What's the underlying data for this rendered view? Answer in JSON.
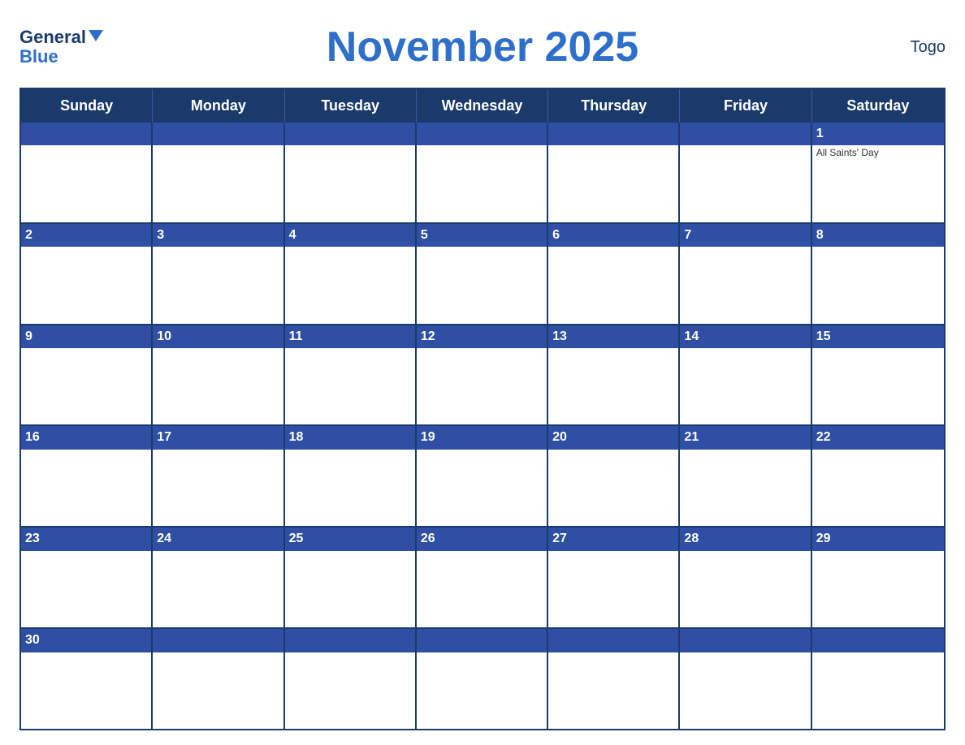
{
  "header": {
    "logo_general": "General",
    "logo_blue": "Blue",
    "title": "November 2025",
    "country": "Togo"
  },
  "days": [
    "Sunday",
    "Monday",
    "Tuesday",
    "Wednesday",
    "Thursday",
    "Friday",
    "Saturday"
  ],
  "weeks": [
    [
      {
        "num": "",
        "event": ""
      },
      {
        "num": "",
        "event": ""
      },
      {
        "num": "",
        "event": ""
      },
      {
        "num": "",
        "event": ""
      },
      {
        "num": "",
        "event": ""
      },
      {
        "num": "",
        "event": ""
      },
      {
        "num": "1",
        "event": "All Saints' Day"
      }
    ],
    [
      {
        "num": "2",
        "event": ""
      },
      {
        "num": "3",
        "event": ""
      },
      {
        "num": "4",
        "event": ""
      },
      {
        "num": "5",
        "event": ""
      },
      {
        "num": "6",
        "event": ""
      },
      {
        "num": "7",
        "event": ""
      },
      {
        "num": "8",
        "event": ""
      }
    ],
    [
      {
        "num": "9",
        "event": ""
      },
      {
        "num": "10",
        "event": ""
      },
      {
        "num": "11",
        "event": ""
      },
      {
        "num": "12",
        "event": ""
      },
      {
        "num": "13",
        "event": ""
      },
      {
        "num": "14",
        "event": ""
      },
      {
        "num": "15",
        "event": ""
      }
    ],
    [
      {
        "num": "16",
        "event": ""
      },
      {
        "num": "17",
        "event": ""
      },
      {
        "num": "18",
        "event": ""
      },
      {
        "num": "19",
        "event": ""
      },
      {
        "num": "20",
        "event": ""
      },
      {
        "num": "21",
        "event": ""
      },
      {
        "num": "22",
        "event": ""
      }
    ],
    [
      {
        "num": "23",
        "event": ""
      },
      {
        "num": "24",
        "event": ""
      },
      {
        "num": "25",
        "event": ""
      },
      {
        "num": "26",
        "event": ""
      },
      {
        "num": "27",
        "event": ""
      },
      {
        "num": "28",
        "event": ""
      },
      {
        "num": "29",
        "event": ""
      }
    ],
    [
      {
        "num": "30",
        "event": ""
      },
      {
        "num": "",
        "event": ""
      },
      {
        "num": "",
        "event": ""
      },
      {
        "num": "",
        "event": ""
      },
      {
        "num": "",
        "event": ""
      },
      {
        "num": "",
        "event": ""
      },
      {
        "num": "",
        "event": ""
      }
    ]
  ]
}
